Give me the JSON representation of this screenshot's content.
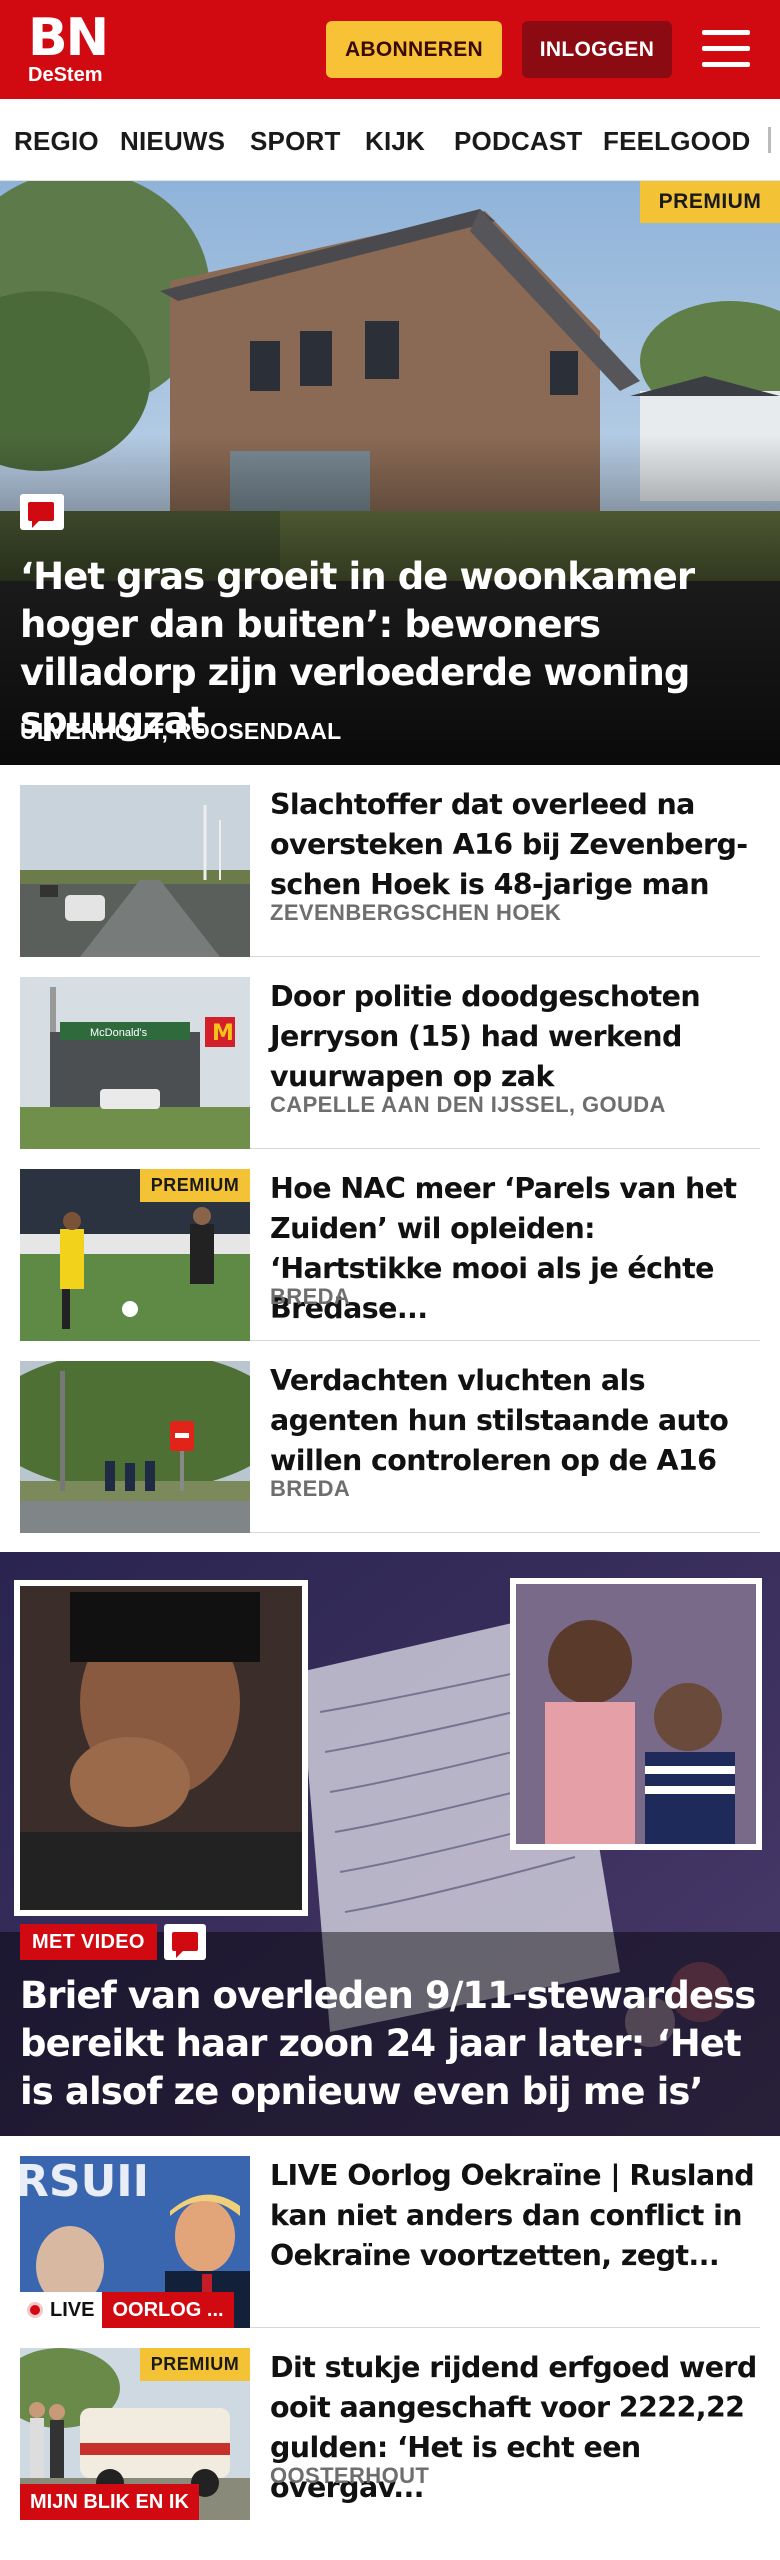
{
  "header": {
    "logo_main": "BN",
    "logo_sub": "DeStem",
    "subscribe_label": "ABONNEREN",
    "login_label": "INLOGGEN",
    "colors": {
      "brand_red": "#d10a11",
      "subscribe_yellow": "#f7c236",
      "login_dark": "#8c0a12"
    }
  },
  "nav": {
    "items": [
      "REGIO",
      "NIEUWS",
      "SPORT",
      "KIJK",
      "PODCAST",
      "FEELGOOD"
    ]
  },
  "hero": {
    "premium_label": "PREMIUM",
    "title": "‘Het gras groeit in de woonkamer hoger dan buiten’: bewoners villadorp zijn verloederde woning spuugzat",
    "location": "ULVENHOUT, ROOSENDAAL",
    "icons": [
      "comment-icon"
    ]
  },
  "articles": [
    {
      "title": "Slachtoffer dat overleed na oversteken A16 bij Zevenberg-schen Hoek is 48-jarige man",
      "location": "ZEVENBERGSCHEN HOEK"
    },
    {
      "title": "Door politie doodgeschoten Jerryson (15) had werkend vuurwapen op zak",
      "location": "CAPELLE AAN DEN IJSSEL, GOUDA"
    },
    {
      "title": "Hoe NAC meer ‘Parels van het Zuiden’ wil opleiden: ‘Hartstikke mooi als je échte Bredase...",
      "location": "BREDA",
      "premium_label": "PREMIUM"
    },
    {
      "title": "Verdachten vluchten als agenten hun stilstaande auto willen controleren op de A16",
      "location": "BREDA"
    }
  ],
  "video_feature": {
    "tag": "MET VIDEO",
    "title": "Brief van overleden 9/11-stewardess bereikt haar zoon 24 jaar later: ‘Het is alsof ze opnieuw even bij me is’"
  },
  "bottom_articles": [
    {
      "title": "LIVE Oorlog Oekraïne | Rusland kan niet anders dan conflict in Oekraïne voortzetten, zegt...",
      "live_label": "LIVE",
      "category": "OORLOG ..."
    },
    {
      "title": "Dit stukje rijdend erfgoed werd ooit aangeschaft voor 2222,22 gulden: ‘Het is echt een overgav...",
      "location": "OOSTERHOUT",
      "premium_label": "PREMIUM",
      "category": "MIJN BLIK EN IK"
    }
  ]
}
